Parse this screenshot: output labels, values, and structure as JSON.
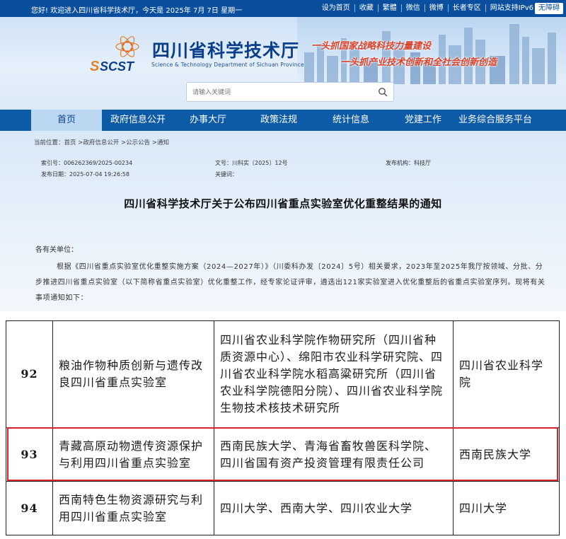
{
  "topbar": {
    "greeting": "您好! 欢迎进入四川省科学技术厅，今天是  2025年 7月 7日  星期一",
    "links": [
      "设为首页",
      "收藏",
      "繁體",
      "微信",
      "微博",
      "长者专区",
      "网站支持IPv6"
    ],
    "elder_button": "无障碍"
  },
  "header": {
    "logo_text": "SCST",
    "site_title": "四川省科学技术厅",
    "site_subtitle": "Science & Technology Department of Sichuan Province",
    "slogan_1": "一头抓国家战略科技力量建设",
    "slogan_2": "一头抓产业技术创新和全社会创新创造"
  },
  "search": {
    "placeholder": "请输入关键词"
  },
  "nav": {
    "items": [
      "首页",
      "政府信息公开",
      "办事大厅",
      "政策法规",
      "统计信息",
      "党建工作",
      "业务综合服务平台"
    ]
  },
  "breadcrumb": {
    "label": "当前位置：",
    "path": "首页 >政府信息公开 >公示公告 >通知"
  },
  "meta": {
    "index_label": "索引号：",
    "index_value": "006262369/2025-00234",
    "docno_label": "文号：",
    "docno_value": "川科实〔2025〕12号",
    "org_label": "发布机构：",
    "org_value": "科技厅",
    "date_label": "发布日期：",
    "date_value": "2025-07-04 19:26:58",
    "keywords_label": "关键词："
  },
  "document": {
    "title": "四川省科学技术厅关于公布四川省重点实验室优化重整结果的通知",
    "salutation": "各有关单位：",
    "paragraph": "根据《四川省重点实验室优化重整实施方案（2024—2027年）》（川委科办发〔2024〕5号）相关要求，2023年至2025年我厅按领域、分批、分步推进四川省重点实验室（以下简称省重点实验室）优化重整工作，经专家论证评审，遴选出121家实验室进入优化重整后的省重点实验室序列。现将有关事项通知如下："
  },
  "table": {
    "rows": [
      {
        "num": "92",
        "name": "粮油作物种质创新与遗传改良四川省重点实验室",
        "units": "四川省农业科学院作物研究所（四川省种质资源中心）、绵阳市农业科学研究院、四川省农业科学院水稻高粱研究所（四川省农业科学院德阳分院）、四川省农业科学院生物技术核技术研究所",
        "lead": "四川省农业科学院"
      },
      {
        "num": "93",
        "name": "青藏高原动物遗传资源保护与利用四川省重点实验室",
        "units": "西南民族大学、青海省畜牧兽医科学院、四川省国有资产投资管理有限责任公司",
        "lead": "西南民族大学"
      },
      {
        "num": "94",
        "name": "西南特色生物资源研究与利用四川省重点实验室",
        "units": "四川大学、西南大学、四川农业大学",
        "lead": "四川大学"
      }
    ]
  },
  "colors": {
    "topbar": "#0a4f9e",
    "nav": "#0d5aa7",
    "nav_active": "#bcd7f1",
    "slogan": "#d9412b",
    "highlight": "#d8232a"
  }
}
